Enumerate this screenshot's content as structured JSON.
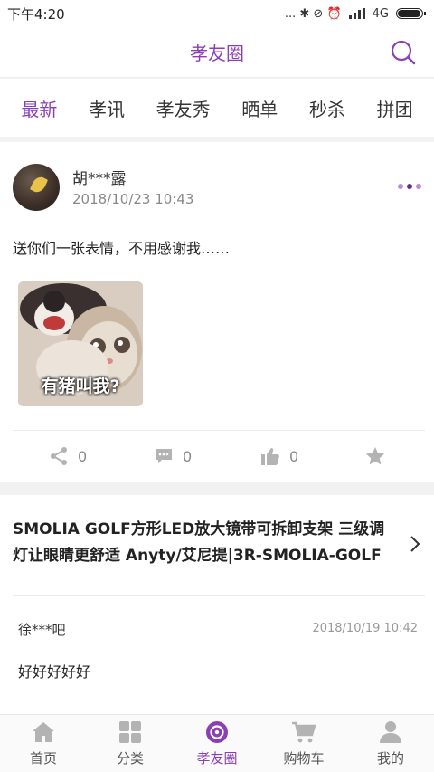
{
  "status_bar": {
    "time": "下午4:20",
    "indicators": "... ✱ ⊘ ⏰",
    "network": "4G",
    "battery_level": 0.9
  },
  "header": {
    "title": "孝友圈",
    "search_icon": "search-icon"
  },
  "tabs": [
    {
      "label": "最新",
      "active": true
    },
    {
      "label": "孝讯",
      "active": false
    },
    {
      "label": "孝友秀",
      "active": false
    },
    {
      "label": "晒单",
      "active": false
    },
    {
      "label": "秒杀",
      "active": false
    },
    {
      "label": "拼团",
      "active": false
    }
  ],
  "post": {
    "username": "胡***露",
    "time": "2018/10/23 10:43",
    "text": "送你们一张表情，不用感谢我……",
    "image_caption": "有猪叫我?",
    "share_count": "0",
    "comment_count": "0",
    "like_count": "0"
  },
  "product": {
    "title": "SMOLIA GOLF方形LED放大镜带可拆卸支架 三级调灯让眼睛更舒适 Anyty/艾尼提|3R-SMOLIA-GOLF",
    "comment": {
      "user": "徐***吧",
      "time": "2018/10/19 10:42",
      "text": "好好好好好"
    }
  },
  "bottom_nav": [
    {
      "label": "首页",
      "icon": "home-icon",
      "active": false
    },
    {
      "label": "分类",
      "icon": "category-icon",
      "active": false
    },
    {
      "label": "孝友圈",
      "icon": "circle-icon",
      "active": true
    },
    {
      "label": "购物车",
      "icon": "cart-icon",
      "active": false
    },
    {
      "label": "我的",
      "icon": "user-icon",
      "active": false
    }
  ],
  "colors": {
    "accent": "#8a3fb5",
    "icon_gray": "#b3b3b3"
  }
}
